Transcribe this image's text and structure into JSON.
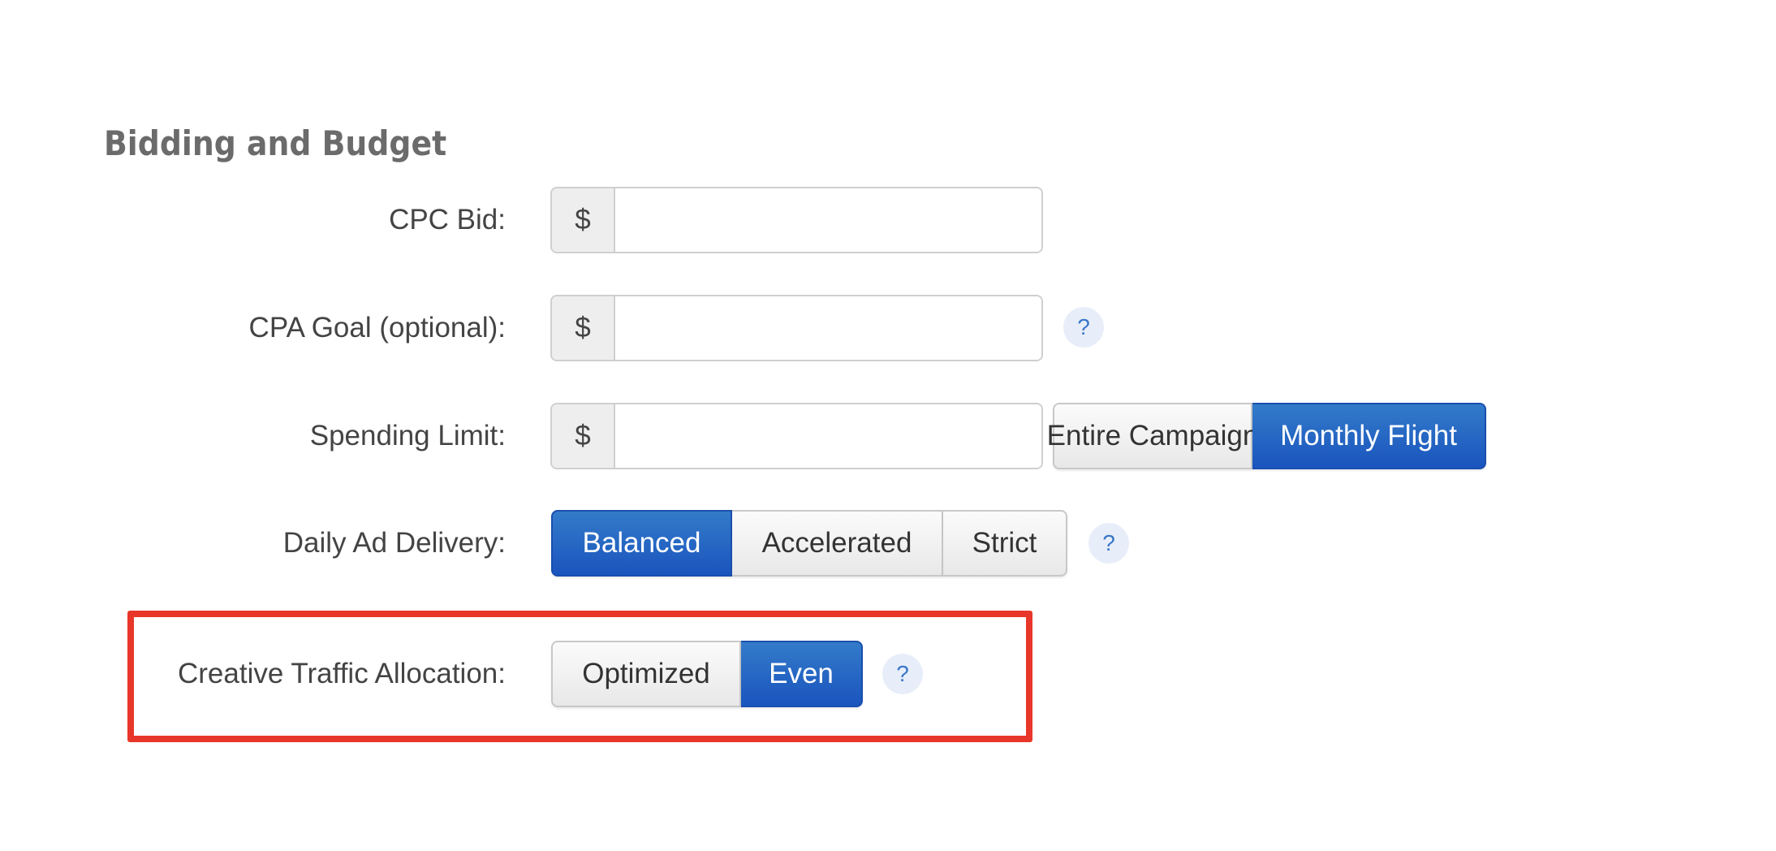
{
  "section": {
    "title": "Bidding and Budget"
  },
  "fields": {
    "cpc_bid": {
      "label": "CPC Bid:",
      "currency_symbol": "$",
      "value": "",
      "placeholder": ""
    },
    "cpa_goal": {
      "label": "CPA Goal (optional):",
      "currency_symbol": "$",
      "value": "",
      "placeholder": "",
      "help": "?"
    },
    "spending_limit": {
      "label": "Spending Limit:",
      "currency_symbol": "$",
      "value": "",
      "placeholder": "",
      "options": [
        {
          "label": "Entire Campaign",
          "selected": false
        },
        {
          "label": "Monthly Flight",
          "selected": true
        }
      ]
    },
    "daily_ad_delivery": {
      "label": "Daily Ad Delivery:",
      "help": "?",
      "options": [
        {
          "label": "Balanced",
          "selected": true
        },
        {
          "label": "Accelerated",
          "selected": false
        },
        {
          "label": "Strict",
          "selected": false
        }
      ]
    },
    "creative_traffic_allocation": {
      "label": "Creative Traffic Allocation:",
      "help": "?",
      "highlighted": true,
      "options": [
        {
          "label": "Optimized",
          "selected": false
        },
        {
          "label": "Even",
          "selected": true
        }
      ]
    }
  },
  "colors": {
    "accent_blue": "#1a54be",
    "highlight_red": "#e8372a",
    "help_icon_bg": "#e8eef9",
    "help_icon_fg": "#3a77c8"
  }
}
